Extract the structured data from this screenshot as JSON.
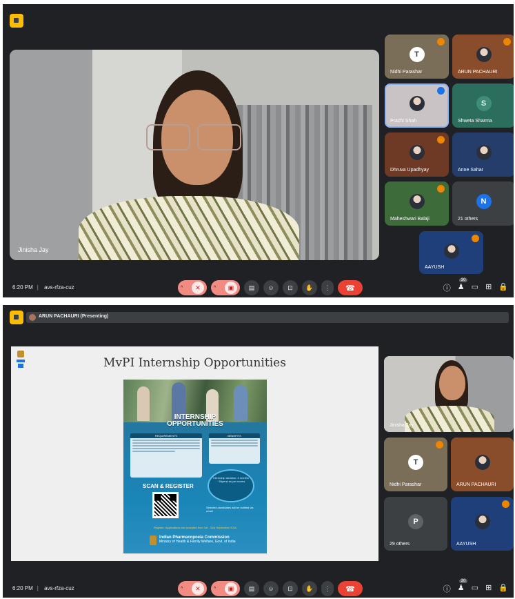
{
  "panel1": {
    "main_speaker": {
      "name": "Jinisha Jay"
    },
    "tiles": [
      {
        "name": "Nidhi Parashar",
        "avatar": "T",
        "avatar_bg": "#ffffff",
        "avatar_fg": "#3c4043",
        "bg": "#7a6e59",
        "mic_off": true
      },
      {
        "name": "ARUN PACHAURI",
        "avatar": "",
        "bg": "#8a4d2b",
        "mic_off": true
      },
      {
        "name": "Prachi Shah",
        "avatar": "",
        "bg": "#c9c3c6",
        "mic_off": true,
        "highlight": true
      },
      {
        "name": "Shweta Sharma",
        "avatar": "S",
        "avatar_bg": "#3f8c7b",
        "avatar_fg": "#d7f0ea",
        "bg": "#2c6e5e",
        "mic_off": false
      },
      {
        "name": "Dhruva Upadhyay",
        "avatar": "",
        "bg": "#6e3a25",
        "mic_off": true
      },
      {
        "name": "Anne Sahar",
        "avatar": "",
        "bg": "#253d6b",
        "mic_off": false
      },
      {
        "name": "Maheshwari Balaji",
        "avatar": "",
        "bg": "#3d6b3a",
        "mic_off": true
      },
      {
        "name": "21 others",
        "avatar": "N",
        "avatar_bg": "#1a73e8",
        "avatar_fg": "#ffffff",
        "bg": "#3c4043",
        "mic_off": false
      },
      {
        "name": "AAYUSH",
        "avatar": "",
        "bg": "#1f3f7a",
        "mic_off": true
      }
    ],
    "bar": {
      "time": "6:20 PM",
      "code": "avs-rfza-cuz"
    }
  },
  "panel2": {
    "presenting_label": "ARUN PACHAURI (Presenting)",
    "slide": {
      "title": "MvPI Internship Opportunities",
      "poster": {
        "heading_line1": "INTERNSHIP",
        "heading_line2": "OPPORTUNITIES",
        "box1_title": "REQUIREMENTS",
        "box2_title": "BENEFITS",
        "scan_label": "SCAN & REGISTER",
        "circle_text": "Internship duration: 3 months · Stipend as per norms",
        "note": "Selected candidates will be notified via email",
        "deadline": "Register: Applications are accepted from 1st - 31st September 2024",
        "footer_title": "Indian Pharmacopoeia Commission",
        "footer_sub": "Ministry of Health & Family Welfare, Govt. of India"
      }
    },
    "tiles": [
      {
        "name": "Jinisha Jay",
        "video": true,
        "bg": "#d9d7d3",
        "mic_off": false,
        "active": true
      },
      {
        "name": "Nidhi Parashar",
        "avatar": "T",
        "avatar_bg": "#ffffff",
        "avatar_fg": "#3c4043",
        "bg": "#7a6e59",
        "mic_off": true
      },
      {
        "name": "ARUN PACHAURI",
        "avatar": "",
        "bg": "#8a4d2b",
        "mic_off": false
      },
      {
        "name": "29 others",
        "avatar": "P",
        "avatar_bg": "#5f6368",
        "avatar_fg": "#ffffff",
        "bg": "#3c4043",
        "mic_off": false
      },
      {
        "name": "AAYUSH",
        "avatar": "",
        "bg": "#1f3f7a",
        "mic_off": true
      }
    ],
    "bar": {
      "time": "6:20 PM",
      "code": "avs-rfza-cuz"
    }
  },
  "controls": {
    "mic_icon": "mic-off-icon",
    "camera_icon": "camera-off-icon",
    "captions_icon": "captions-icon",
    "emoji_icon": "emoji-icon",
    "present_icon": "present-icon",
    "raise_hand_icon": "raise-hand-icon",
    "more_icon": "more-options-icon",
    "end_call_icon": "end-call-icon",
    "people_badge": "30",
    "colors": {
      "end_call": "#ea4335",
      "muted": "#f28b82",
      "bar_bg": "#202124",
      "brand": "#fbbc04"
    }
  }
}
